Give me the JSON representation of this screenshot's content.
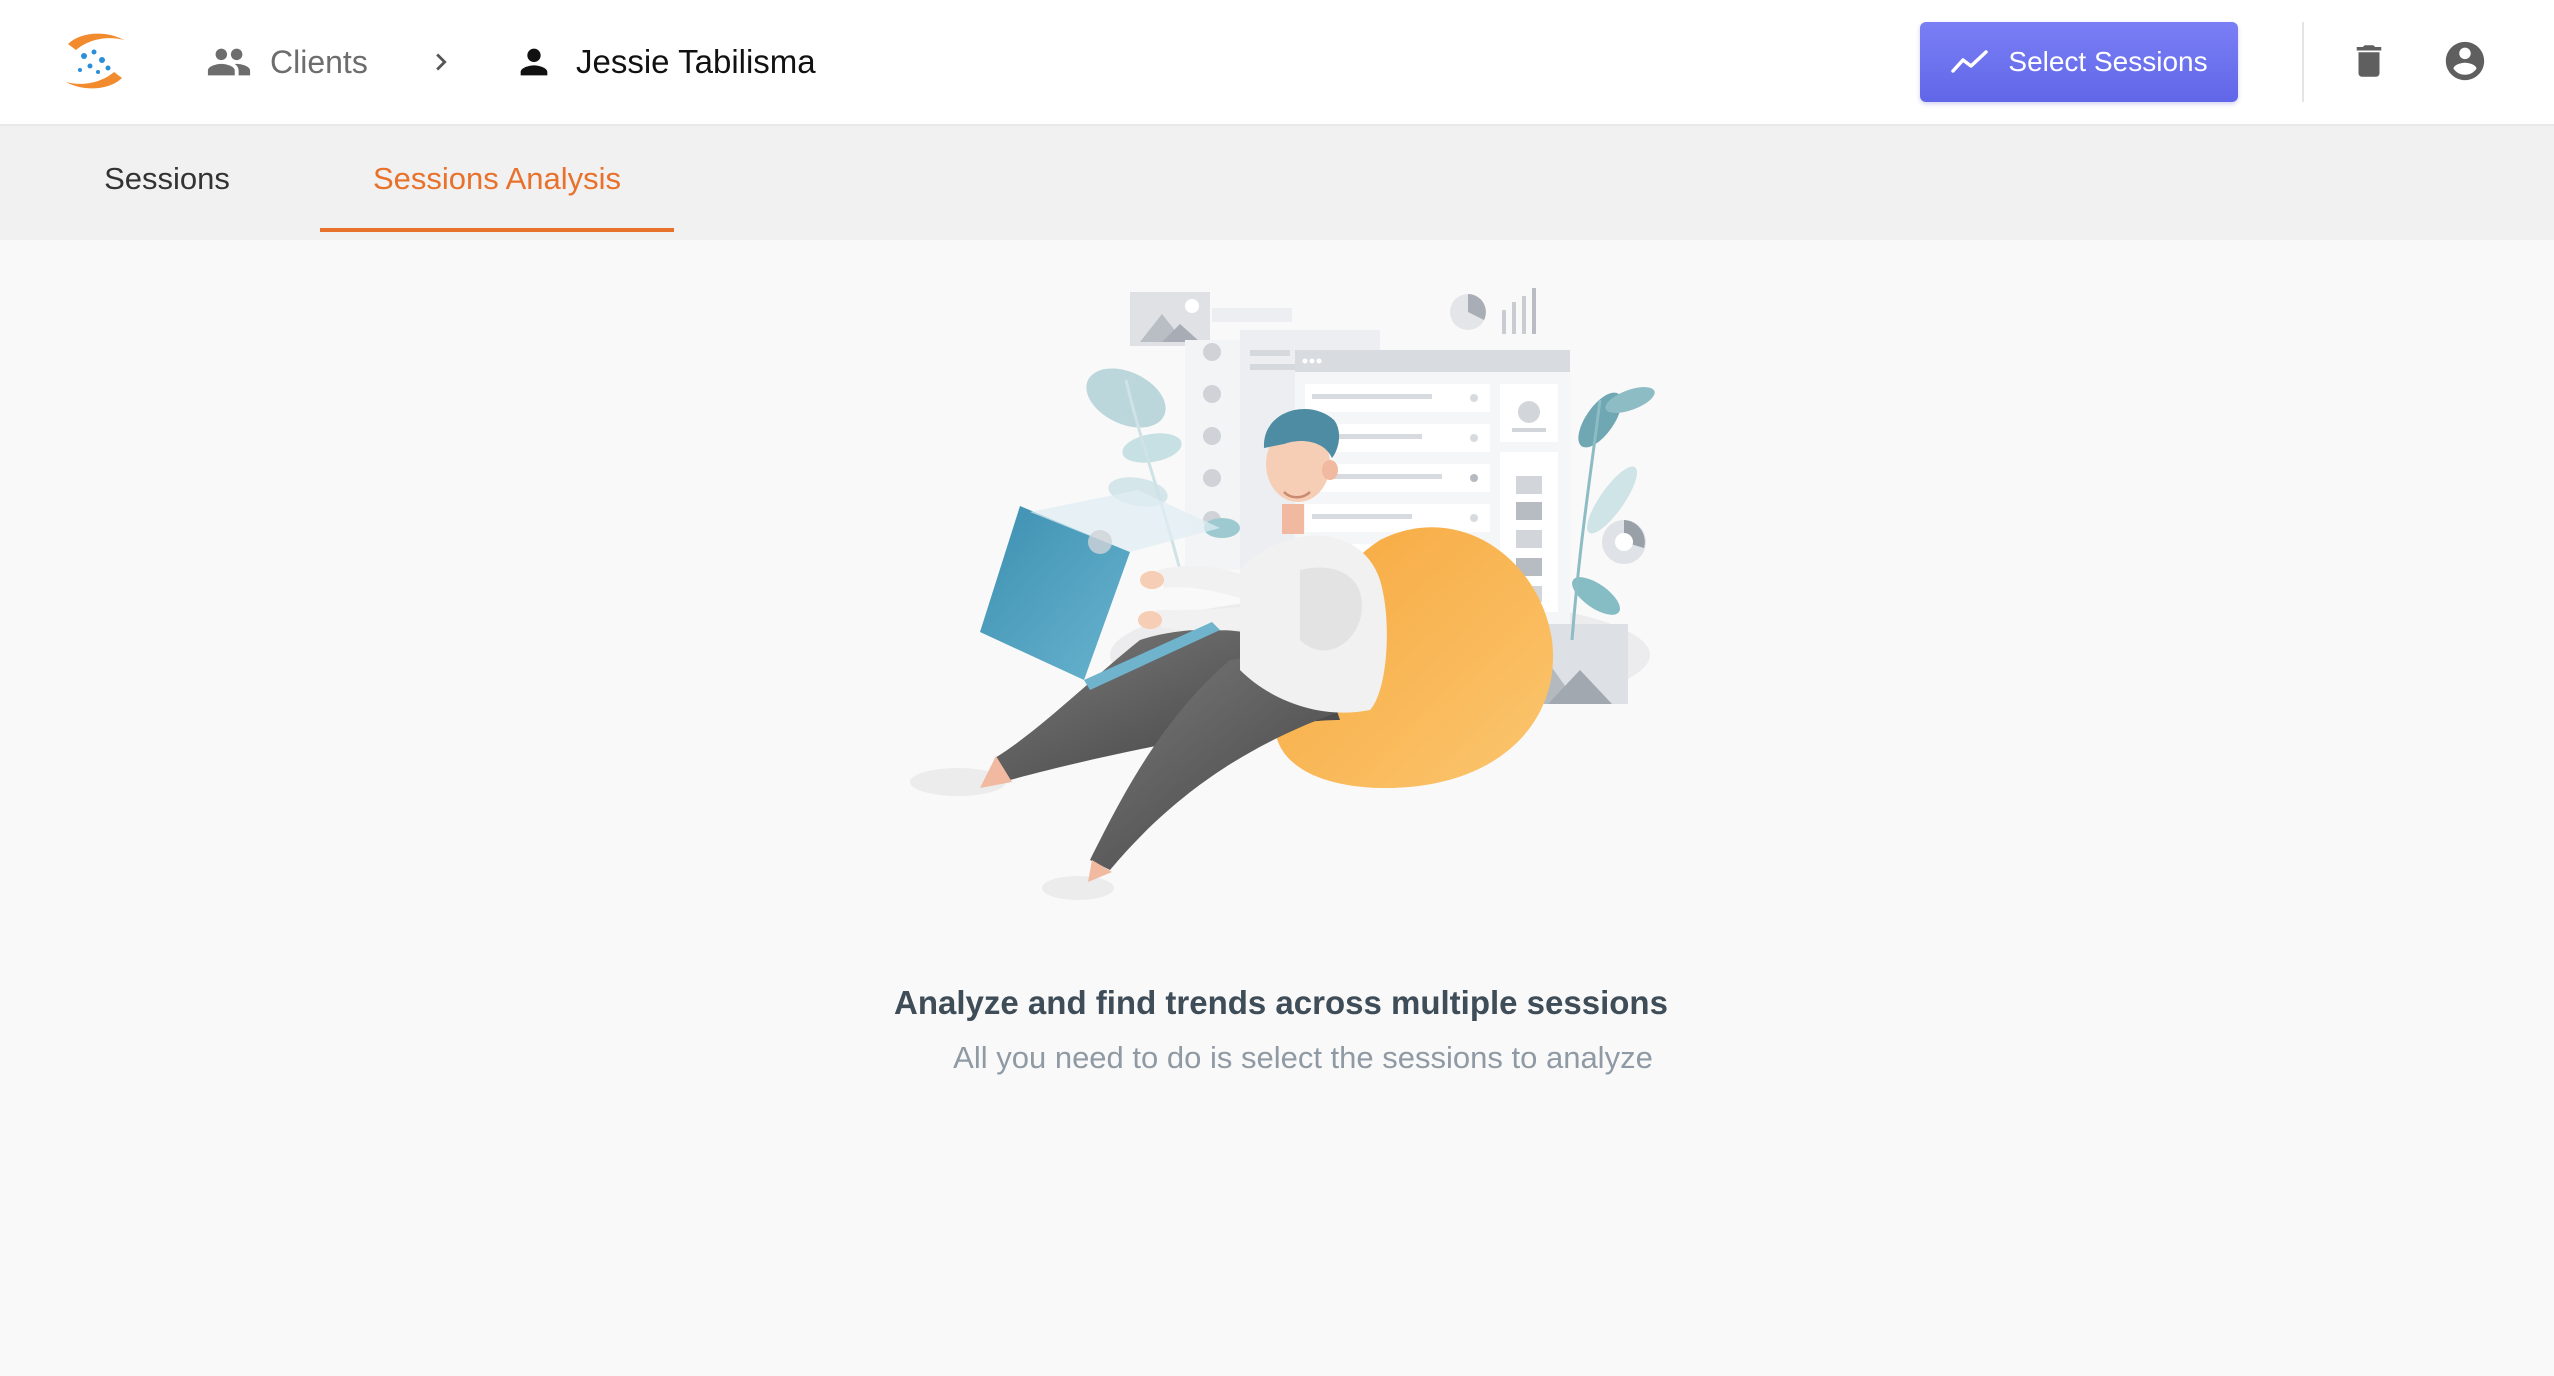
{
  "header": {
    "breadcrumb": {
      "clients_label": "Clients",
      "client_name": "Jessie Tabilisma"
    },
    "select_sessions_label": "Select Sessions",
    "icons": [
      "app-logo-icon",
      "clients-icon",
      "chevron-right-icon",
      "person-icon",
      "trend-line-icon",
      "trash-icon",
      "account-circle-icon"
    ]
  },
  "tabs": [
    {
      "label": "Sessions",
      "active": false
    },
    {
      "label": "Sessions Analysis",
      "active": true
    }
  ],
  "empty_state": {
    "title": "Analyze and find trends across multiple sessions",
    "subtitle": "All you need to do is select the sessions to analyze"
  },
  "colors": {
    "accent": "#e8712b",
    "button": "#6d72ef",
    "title_text": "#3f4d58",
    "subtitle_text": "#8f9aa4"
  }
}
